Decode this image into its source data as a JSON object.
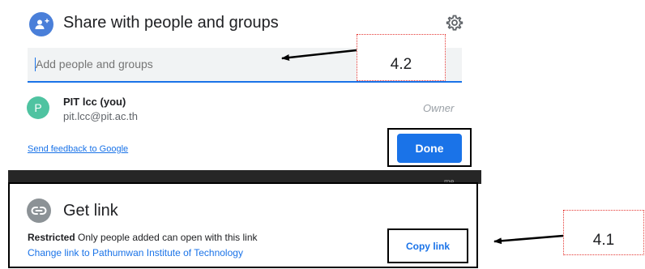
{
  "share_dialog": {
    "title": "Share with people and groups",
    "input_placeholder": "Add people and groups",
    "person": {
      "avatar_initial": "P",
      "name": "PIT lcc (you)",
      "email": "pit.lcc@pit.ac.th",
      "role": "Owner"
    },
    "feedback_link": "Send feedback to Google",
    "done_label": "Done",
    "background_text": "me"
  },
  "get_link": {
    "title": "Get link",
    "restricted_label": "Restricted",
    "restricted_desc": " Only people added can open with this link",
    "change_link": "Change link to Pathumwan Institute of Technology",
    "copy_label": "Copy link"
  },
  "annotations": {
    "label_1": "4.2",
    "label_2": "4.1"
  },
  "icons": {
    "share": "person-add-icon",
    "settings": "gear-icon",
    "link": "link-icon",
    "arrow": "arrow-left-icon"
  },
  "colors": {
    "accent": "#1a73e8",
    "share_icon_bg": "#4a7fd9",
    "avatar_bg": "#4fc3a1",
    "link_icon_bg": "#8c9296",
    "annotation_border": "#e53935"
  }
}
